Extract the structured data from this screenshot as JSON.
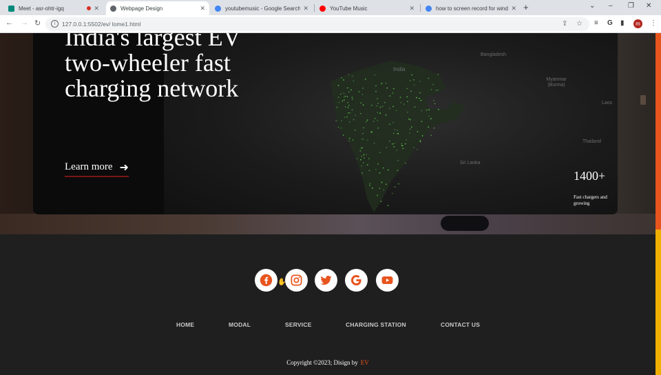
{
  "browser": {
    "tabs": [
      {
        "title": "Meet - asr-ohtr-igq",
        "active": false
      },
      {
        "title": "Webpage Design",
        "active": true
      },
      {
        "title": "youtubemusic - Google Search",
        "active": false
      },
      {
        "title": "YouTube Music",
        "active": false
      },
      {
        "title": "how to screen record for window",
        "active": false
      }
    ],
    "url": "127.0.0.1:5502/ev/ lome1.html",
    "profile_initial": "m"
  },
  "hero": {
    "headline": "India's largest EV two-wheeler fast charging network",
    "cta_label": "Learn more",
    "stat_value": "1400+",
    "stat_caption": "Fast chargers and growing"
  },
  "map_labels": [
    "Bangladesh",
    "India",
    "Myanmar (Burma)",
    "Laos",
    "Thailand",
    "Sri Lanka"
  ],
  "social_icons": [
    "facebook-icon",
    "instagram-icon",
    "twitter-icon",
    "google-icon",
    "youtube-icon"
  ],
  "footer": {
    "nav": [
      "HOME",
      "MODAL",
      "SERVICE",
      "CHARGING STATION",
      "CONTACT US"
    ],
    "copyright": "Copyright ©2023; Disign by",
    "brand": "EV"
  },
  "colors": {
    "accent": "#e8541e",
    "social_icon": "#e8541e",
    "footer_bg": "#1f1f1f",
    "scrollbar_track": "#f0b000"
  }
}
